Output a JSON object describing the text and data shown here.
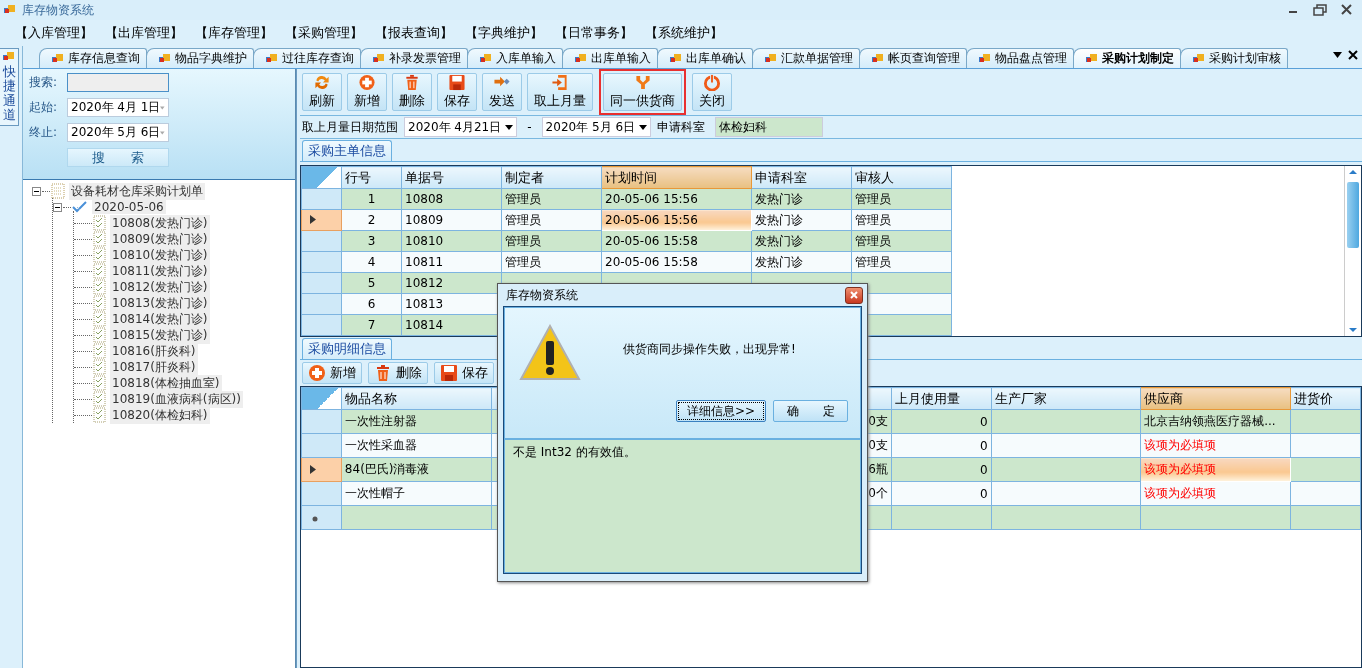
{
  "window": {
    "title": "库存物资系统"
  },
  "menu": [
    "【入库管理】",
    "【出库管理】",
    "【库存管理】",
    "【采购管理】",
    "【报表查询】",
    "【字典维护】",
    "【日常事务】",
    "【系统维护】"
  ],
  "quick_panel": {
    "label": "快捷通道"
  },
  "tabs": [
    {
      "label": "库存信息查询",
      "selected": false
    },
    {
      "label": "物品字典维护",
      "selected": false
    },
    {
      "label": "过往库存查询",
      "selected": false
    },
    {
      "label": "补录发票管理",
      "selected": false
    },
    {
      "label": "入库单输入",
      "selected": false
    },
    {
      "label": "出库单输入",
      "selected": false
    },
    {
      "label": "出库单确认",
      "selected": false
    },
    {
      "label": "汇款单据管理",
      "selected": false
    },
    {
      "label": "帐页查询管理",
      "selected": false
    },
    {
      "label": "物品盘点管理",
      "selected": false
    },
    {
      "label": "采购计划制定",
      "selected": true
    },
    {
      "label": "采购计划审核",
      "selected": false
    }
  ],
  "search_panel": {
    "search_label": "搜索:",
    "start_label": "起始:",
    "start_date": "2020年 4月 1日",
    "end_label": "终止:",
    "end_date": "2020年 5月 6日",
    "search_button": "搜　　索"
  },
  "tree": {
    "label": "设备耗材仓库采购计划单",
    "kind": "root",
    "expanded": true,
    "children": [
      {
        "label": "2020-05-06",
        "kind": "date",
        "expanded": true,
        "children": [
          {
            "label": "10808(发热门诊)",
            "kind": "plan"
          },
          {
            "label": "10809(发热门诊)",
            "kind": "plan"
          },
          {
            "label": "10810(发热门诊)",
            "kind": "plan"
          },
          {
            "label": "10811(发热门诊)",
            "kind": "plan"
          },
          {
            "label": "10812(发热门诊)",
            "kind": "plan"
          },
          {
            "label": "10813(发热门诊)",
            "kind": "plan"
          },
          {
            "label": "10814(发热门诊)",
            "kind": "plan"
          },
          {
            "label": "10815(发热门诊)",
            "kind": "plan"
          },
          {
            "label": "10816(肝炎科)",
            "kind": "plan"
          },
          {
            "label": "10817(肝炎科)",
            "kind": "plan"
          },
          {
            "label": "10818(体检抽血室)",
            "kind": "plan"
          },
          {
            "label": "10819(血液病科(病区))",
            "kind": "plan"
          },
          {
            "label": "10820(体检妇科)",
            "kind": "plan"
          }
        ]
      }
    ]
  },
  "toolbar": [
    {
      "label": "刷新",
      "kind": "refresh",
      "highlighted": false
    },
    {
      "label": "新增",
      "kind": "add",
      "highlighted": false
    },
    {
      "label": "删除",
      "kind": "delete",
      "highlighted": false
    },
    {
      "label": "保存",
      "kind": "save",
      "highlighted": false
    },
    {
      "label": "发送",
      "kind": "send",
      "highlighted": false
    },
    {
      "label": "取上月量",
      "kind": "fetch",
      "highlighted": false
    },
    {
      "label": "同一供货商",
      "kind": "sync",
      "highlighted": true
    },
    {
      "label": "关闭",
      "kind": "close",
      "highlighted": false
    }
  ],
  "range_bar": {
    "label": "取上月量日期范围",
    "from": "2020年 4月21日",
    "separator": "-",
    "to": "2020年 5月 6日",
    "dept_label": "申请科室",
    "dept_value": "体检妇科"
  },
  "master": {
    "title": "采购主单信息",
    "columns": [
      {
        "label": "行号",
        "selected": false
      },
      {
        "label": "单据号",
        "selected": false
      },
      {
        "label": "制定者",
        "selected": false
      },
      {
        "label": "计划时间",
        "selected": true
      },
      {
        "label": "申请科室",
        "selected": false
      },
      {
        "label": "审核人",
        "selected": false
      }
    ],
    "rows": [
      {
        "selected": false,
        "cells": [
          "1",
          "10808",
          "管理员",
          "20-05-06 15:56",
          "发热门诊",
          "管理员"
        ]
      },
      {
        "selected": true,
        "cells": [
          "2",
          "10809",
          "管理员",
          "20-05-06 15:56",
          "发热门诊",
          "管理员"
        ]
      },
      {
        "selected": false,
        "cells": [
          "3",
          "10810",
          "管理员",
          "20-05-06 15:58",
          "发热门诊",
          "管理员"
        ]
      },
      {
        "selected": false,
        "cells": [
          "4",
          "10811",
          "管理员",
          "20-05-06 15:58",
          "发热门诊",
          "管理员"
        ]
      },
      {
        "selected": false,
        "cells": [
          "5",
          "10812",
          null,
          null,
          null,
          null
        ]
      },
      {
        "selected": false,
        "cells": [
          "6",
          "10813",
          null,
          null,
          null,
          null
        ]
      },
      {
        "selected": false,
        "cells": [
          "7",
          "10814",
          null,
          null,
          null,
          null
        ]
      }
    ]
  },
  "detail": {
    "title": "采购明细信息",
    "toolbar": [
      {
        "label": "新增",
        "kind": "add"
      },
      {
        "label": "删除",
        "kind": "delete"
      },
      {
        "label": "保存",
        "kind": "save"
      }
    ],
    "columns": [
      {
        "label": "物品名称",
        "selected": false
      },
      {
        "selected": false
      },
      {
        "selected": false
      },
      {
        "label": "上月使用量",
        "selected": false
      },
      {
        "label": "生产厂家",
        "selected": false
      },
      {
        "label": "供应商",
        "selected": true
      },
      {
        "label": "进货价",
        "selected": false
      }
    ],
    "rows": [
      {
        "selected": false,
        "supplier_error": false,
        "cells": [
          "一次性注射器",
          null,
          "0支",
          "0",
          null,
          "北京吉纳领燕医疗器械...",
          null
        ]
      },
      {
        "selected": false,
        "supplier_error": true,
        "cells": [
          "一次性采血器",
          null,
          "0支",
          "0",
          null,
          "该项为必填项",
          null
        ]
      },
      {
        "selected": true,
        "supplier_error": true,
        "cells": [
          "84(巴氏)消毒液",
          null,
          "6瓶",
          "0",
          null,
          "该项为必填项",
          null
        ]
      },
      {
        "selected": false,
        "supplier_error": true,
        "cells": [
          "一次性帽子",
          null,
          "0个",
          "0",
          null,
          "该项为必填项",
          null
        ]
      }
    ],
    "new_row": true
  },
  "dialog": {
    "title": "库存物资系统",
    "message": "供货商同步操作失败，出现异常!",
    "buttons": [
      {
        "label": "详细信息>>",
        "focused": true
      },
      {
        "label": "确　　定",
        "focused": false
      }
    ],
    "details": "不是 Int32 的有效值。"
  }
}
